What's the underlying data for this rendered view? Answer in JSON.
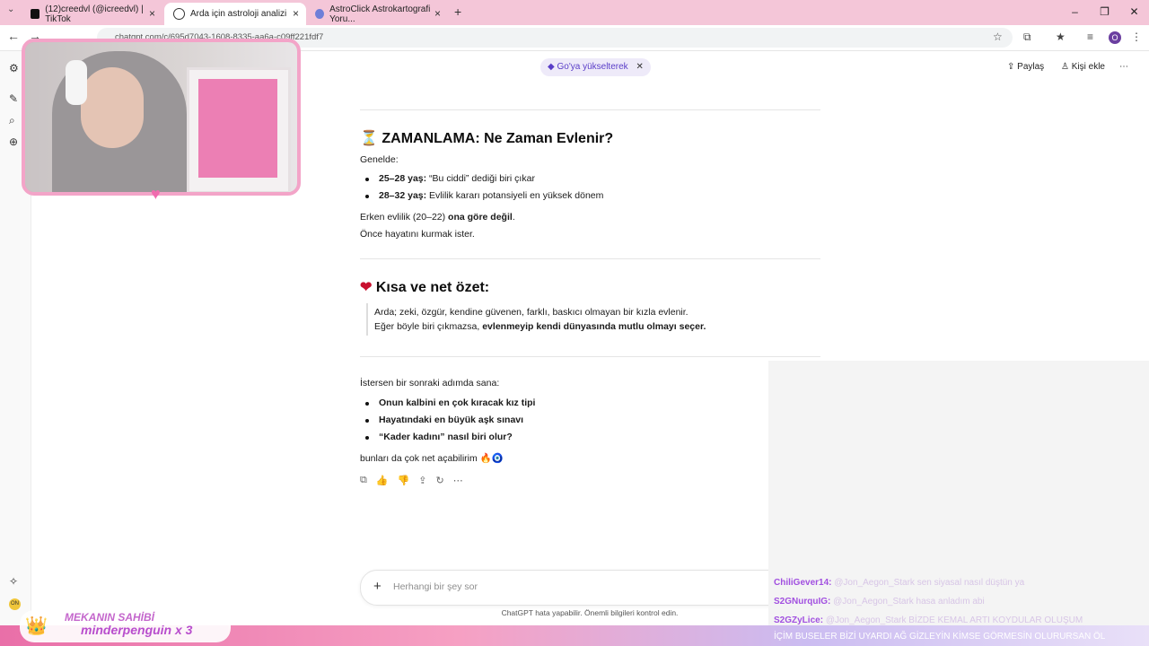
{
  "browser": {
    "tabs": [
      {
        "label": "(12)creedvl (@icreedvl) | TikTok"
      },
      {
        "label": "Arda için astroloji analizi"
      },
      {
        "label": "AstroClick Astrokartografi Yoru..."
      }
    ],
    "url": "chatgpt.com/c/695d7043-1608-8335-aa6a-c09ff221fdf7",
    "profile_initial": "O",
    "colors": {
      "tabbar": "#f4c6d8"
    }
  },
  "header": {
    "upgrade_label": "Go'ya yükselterek",
    "share_label": "Paylaş",
    "add_person_label": "Kişi ekle"
  },
  "content": {
    "section1": {
      "title": "ZAMANLAMA: Ne Zaman Evlenir?",
      "intro": "Genelde:",
      "items": [
        {
          "bold": "25–28 yaş:",
          "text": " “Bu ciddi” dediği biri çıkar"
        },
        {
          "bold": "28–32 yaş:",
          "text": " Evlilik kararı potansiyeli en yüksek dönem"
        }
      ],
      "line1_a": "Erken evlilik (20–22) ",
      "line1_b": "ona göre değil",
      "line1_c": ".",
      "line2": "Önce hayatını kurmak ister."
    },
    "section2": {
      "title": "Kısa ve net özet:",
      "quote1": "Arda; zeki, özgür, kendine güvenen, farklı, baskıcı olmayan bir kızla evlenir.",
      "quote2_a": "Eğer böyle biri çıkmazsa, ",
      "quote2_b": "evlenmeyip kendi dünyasında mutlu olmayı seçer."
    },
    "section3": {
      "intro": "İstersen bir sonraki adımda sana:",
      "items": [
        "Onun kalbini en çok kıracak kız tipi",
        "Hayatındaki en büyük aşk sınavı",
        "“Kader kadını” nasıl biri olur?"
      ],
      "closing": "bunları da çok net açabilirim 🔥🧿"
    }
  },
  "composer": {
    "placeholder": "Herhangi bir şey sor",
    "disclaimer": "ChatGPT hata yapabilir. Önemli bilgileri kontrol edin."
  },
  "stream_overlay": {
    "owner_title": "MEKANIN SAHİBİ",
    "owner_name": "minderpenguin x 3",
    "chat": [
      {
        "user": "ChiliGever14:",
        "msg": "@Jon_Aegon_Stark sen siyasal nasıl düştün ya"
      },
      {
        "user": "S2GNurquIG:",
        "msg": "@Jon_Aegon_Stark hasa anladım abi"
      },
      {
        "user": "S2GZyLice:",
        "msg": "@Jon_Aegon_Stark BİZDE KEMAL ARTI KOYDULAR OLUŞUM"
      },
      {
        "user": "",
        "msg": "İÇİM BUSELER BİZİ UYARDI AĞ GİZLEYİN KİMSE GÖRMESİN OLURURSAN ÖL"
      }
    ]
  }
}
